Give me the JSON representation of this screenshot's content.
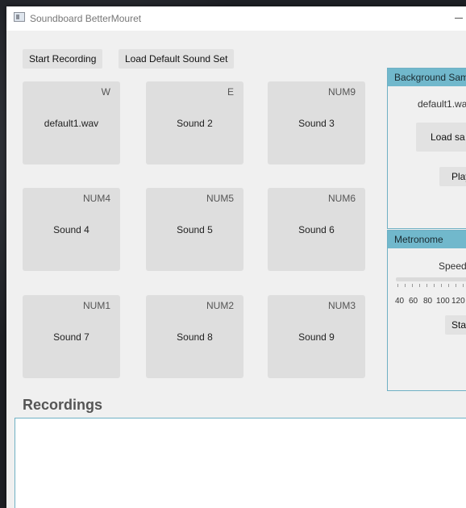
{
  "window": {
    "title": "Soundboard BetterMouret"
  },
  "toolbar": {
    "start_recording": "Start Recording",
    "load_default": "Load Default Sound Set"
  },
  "pads": [
    {
      "key": "W",
      "sound": "default1.wav"
    },
    {
      "key": "E",
      "sound": "Sound 2"
    },
    {
      "key": "NUM9",
      "sound": "Sound 3"
    },
    {
      "key": "NUM4",
      "sound": "Sound 4"
    },
    {
      "key": "NUM5",
      "sound": "Sound 5"
    },
    {
      "key": "NUM6",
      "sound": "Sound 6"
    },
    {
      "key": "NUM1",
      "sound": "Sound 7"
    },
    {
      "key": "NUM2",
      "sound": "Sound 8"
    },
    {
      "key": "NUM3",
      "sound": "Sound 9"
    }
  ],
  "background_panel": {
    "title": "Background Sam",
    "file": "default1.wa",
    "load_button": "Load sa",
    "play_button": "Play"
  },
  "metronome": {
    "title": "Metronome",
    "speed_label": "Speed",
    "tick_labels": [
      "40",
      "60",
      "80",
      "100",
      "120"
    ],
    "start_button": "Star"
  },
  "recordings": {
    "title": "Recordings"
  }
}
